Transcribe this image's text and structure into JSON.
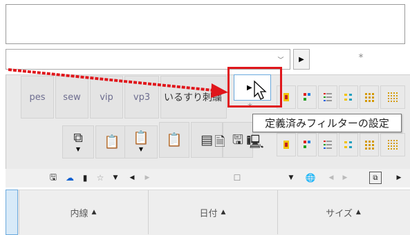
{
  "top_field": {
    "value": ""
  },
  "path_combo": {
    "value": "",
    "dropdown_icon": "chevron-down-icon",
    "go_icon": "play-right-icon"
  },
  "asterisk": "*",
  "filter_buttons": [
    {
      "label": "pes"
    },
    {
      "label": "sew"
    },
    {
      "label": "vip"
    },
    {
      "label": "vp3"
    },
    {
      "label": "いるすり刺繍"
    }
  ],
  "preset_filter": {
    "icon": "play-right-icon",
    "tooltip": "定義済みフィルターの設定",
    "asterisk": "*"
  },
  "tools": [
    {
      "icon": "copy-icon",
      "glyph": "⧉"
    },
    {
      "icon": "paste-icon",
      "glyph": "📋"
    },
    {
      "icon": "paste-shortcut-icon",
      "glyph": "📋"
    },
    {
      "icon": "paste-special-icon",
      "glyph": "📋"
    },
    {
      "icon": "copy-to-icon",
      "glyph": "▤"
    },
    {
      "icon": "save-icon",
      "glyph": "🖫"
    },
    {
      "icon": "file-props-icon",
      "glyph": "🗎"
    },
    {
      "icon": "computer-icon",
      "glyph": "🖳"
    }
  ],
  "small_toolbar": {
    "save_icon": "🖫",
    "cloud_icon": "☁",
    "sd_card_icon": "▮",
    "favorite_icon": "☆",
    "dropdown": "▼",
    "back": "◀",
    "forward": "▶",
    "checkbox": "☐",
    "globe_icon": "🌐",
    "shortcut_icon": "⧉"
  },
  "columns": [
    {
      "label": "内線",
      "sort": "▲"
    },
    {
      "label": "日付",
      "sort": "▲"
    },
    {
      "label": "サイズ",
      "sort": "▲"
    }
  ],
  "colors": {
    "highlight": "#e0161b",
    "arrow": "#e0161b",
    "selected_border": "#6aa9dd",
    "toolbar_bg": "#eaeaea"
  }
}
